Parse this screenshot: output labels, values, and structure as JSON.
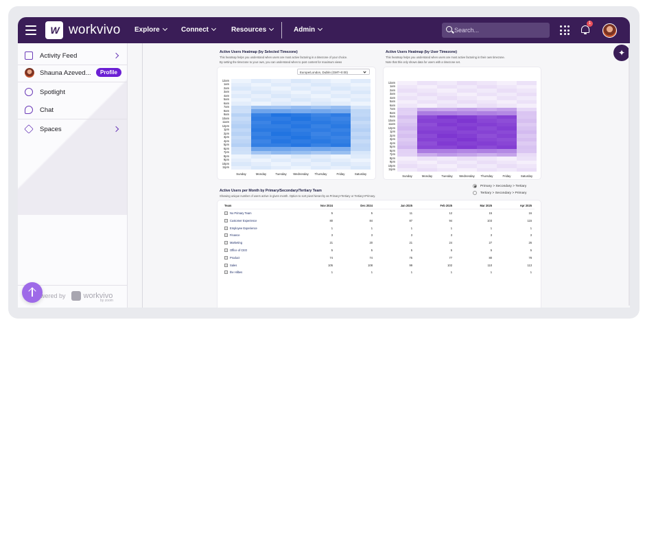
{
  "app": {
    "logo_text": "workvivo",
    "nav": [
      {
        "label": "Explore"
      },
      {
        "label": "Connect"
      },
      {
        "label": "Resources"
      },
      {
        "label": "Admin"
      }
    ],
    "search_placeholder": "Search...",
    "notification_count": "1"
  },
  "sidebar": {
    "items": [
      {
        "label": "Activity Feed"
      },
      {
        "label": "Shauna Azeved..."
      },
      {
        "label": "Spotlight"
      },
      {
        "label": "Chat"
      },
      {
        "label": "Spaces"
      }
    ],
    "profile_badge": "Profile",
    "powered_by": "Powered by",
    "powered_logo": "workvivo",
    "powered_sub": "by zoom"
  },
  "heatmap_selected": {
    "title": "Active Users Heatmap (by Selected Timezone)",
    "desc1": "This heatmap helps you understand when users are most active factoring in a timezone of your choice.",
    "desc2": "By setting the timezone to your own, you can understand when to post content for maximum views",
    "timezone": "Europe/London, Dublin (GMT+0:00)",
    "accent": "#1a6fe0"
  },
  "heatmap_user": {
    "title": "Active Users Heatmap (by User Timezone)",
    "desc1": "This heatmap helps you understand when users are most active factoring in their own timezone.",
    "desc2": "Note that this only shows data for users with a timezone set.",
    "accent": "#7a2fd0"
  },
  "heatmap_axes": {
    "hours": [
      "12am",
      "1am",
      "2am",
      "3am",
      "4am",
      "5am",
      "6am",
      "7am",
      "8am",
      "9am",
      "10am",
      "11am",
      "12pm",
      "1pm",
      "2pm",
      "3pm",
      "4pm",
      "5pm",
      "6pm",
      "7pm",
      "8pm",
      "9pm",
      "10pm",
      "11pm"
    ],
    "days": [
      "Sunday",
      "Monday",
      "Tuesday",
      "Wednesday",
      "Thursday",
      "Friday",
      "Saturday"
    ]
  },
  "table_section": {
    "title": "Active Users per Month by Primary/Secondary/Tertiary Team",
    "desc": "Showing unique number of users active in given month. Option to sort pivot hierarchy as Primary>Tertiary or Tertiary>Primary.",
    "radio1": "Primary > Secondary > Tertiary",
    "radio2": "Tertiary > Secondary > Primary"
  },
  "table": {
    "columns": [
      "Team",
      "Nov 2024",
      "Dec 2024",
      "Jan 2025",
      "Feb 2025",
      "Mar 2025",
      "Apr 2025"
    ],
    "rows": [
      {
        "team": "No Primary Team",
        "values": [
          "5",
          "5",
          "11",
          "12",
          "15",
          "16"
        ]
      },
      {
        "team": "Customer Experience",
        "values": [
          "80",
          "84",
          "87",
          "94",
          "103",
          "115"
        ]
      },
      {
        "team": "Employee Experience",
        "values": [
          "1",
          "1",
          "1",
          "1",
          "1",
          "1"
        ]
      },
      {
        "team": "Finance",
        "values": [
          "3",
          "3",
          "3",
          "3",
          "3",
          "3"
        ]
      },
      {
        "team": "Marketing",
        "values": [
          "21",
          "20",
          "21",
          "24",
          "27",
          "26"
        ]
      },
      {
        "team": "Office of CEO",
        "values": [
          "5",
          "5",
          "5",
          "5",
          "5",
          "5"
        ]
      },
      {
        "team": "Product",
        "values": [
          "74",
          "74",
          "75",
          "77",
          "80",
          "78"
        ]
      },
      {
        "team": "Sales",
        "values": [
          "105",
          "108",
          "99",
          "102",
          "110",
          "113"
        ]
      },
      {
        "team": "the Hilbes",
        "values": [
          "1",
          "1",
          "1",
          "1",
          "1",
          "1"
        ]
      }
    ]
  }
}
